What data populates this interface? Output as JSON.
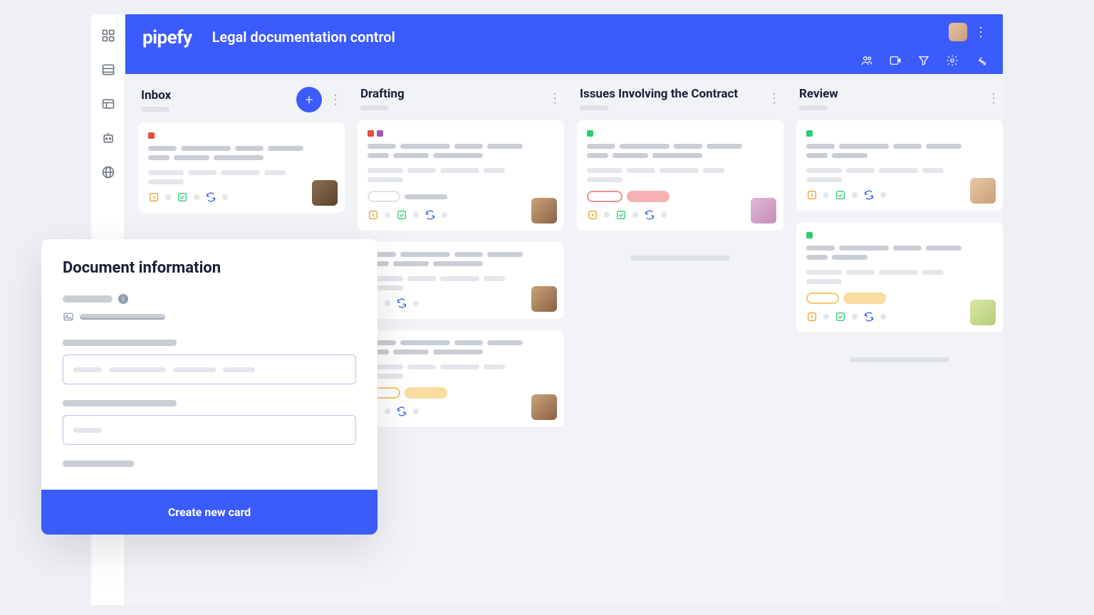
{
  "app": {
    "logo": "pipefy",
    "title": "Legal documentation control"
  },
  "columns": [
    {
      "id": "inbox",
      "title": "Inbox",
      "hasAdd": true
    },
    {
      "id": "drafting",
      "title": "Drafting",
      "hasAdd": false
    },
    {
      "id": "issues",
      "title": "Issues Involving the Contract",
      "hasAdd": false
    },
    {
      "id": "review",
      "title": "Review",
      "hasAdd": false
    }
  ],
  "modal": {
    "title": "Document information",
    "submit_label": "Create new card"
  },
  "colors": {
    "primary": "#3b5bfd",
    "tag_red": "#e84c3d",
    "tag_purple": "#9b59b6",
    "tag_green": "#2ecc71"
  }
}
